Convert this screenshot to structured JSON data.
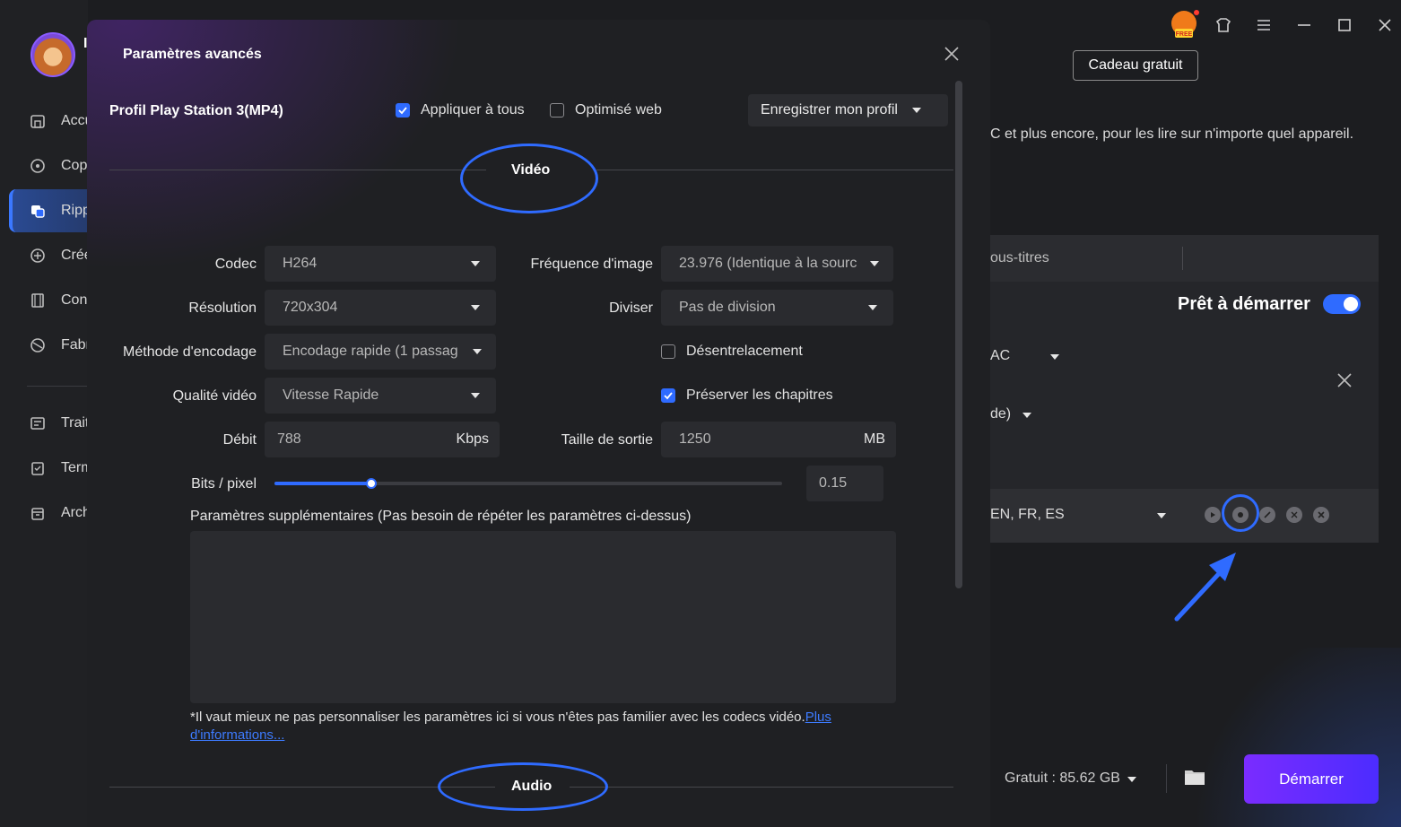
{
  "sidebar": {
    "logo_letter": "I",
    "items": [
      {
        "label": "Accueil",
        "icon": "home-icon"
      },
      {
        "label": "Copier",
        "icon": "copy-disc-icon"
      },
      {
        "label": "Ripper",
        "icon": "ripper-icon"
      },
      {
        "label": "Créer",
        "icon": "create-disc-icon"
      },
      {
        "label": "Convertir",
        "icon": "film-icon"
      },
      {
        "label": "Fabriquer",
        "icon": "fab-disc-icon"
      },
      {
        "label": "Traitement",
        "icon": "batch-icon"
      },
      {
        "label": "Terminé",
        "icon": "clipboard-icon"
      },
      {
        "label": "Archive",
        "icon": "archive-icon"
      }
    ],
    "active_index": 2
  },
  "window": {
    "gift_button": "Cadeau gratuit",
    "promo_badge": "FREE"
  },
  "background": {
    "description": "C et plus encore, pour les lire sur n'importe quel appareil.",
    "tab_subtitles": "ous-titres",
    "ready_label": "Prêt à démarrer",
    "audio_codec_partial": "AC",
    "mode_partial": "de)",
    "subtitle_langs": "EN, FR, ES",
    "free_space": "Gratuit : 85.62 GB",
    "start_button": "Démarrer"
  },
  "modal": {
    "title": "Paramètres avancés",
    "profile_name": "Profil Play Station 3(MP4)",
    "apply_all": {
      "label": "Appliquer à tous",
      "checked": true
    },
    "web_optimized": {
      "label": "Optimisé web",
      "checked": false
    },
    "save_profile": "Enregistrer mon profil",
    "video_section": "Vidéo",
    "audio_section": "Audio",
    "fields": {
      "codec": {
        "label": "Codec",
        "value": "H264"
      },
      "resolution": {
        "label": "Résolution",
        "value": "720x304"
      },
      "encoding_method": {
        "label": "Méthode d'encodage",
        "value": "Encodage rapide (1 passag"
      },
      "video_quality": {
        "label": "Qualité vidéo",
        "value": "Vitesse Rapide"
      },
      "bitrate": {
        "label": "Débit",
        "value": "788",
        "unit": "Kbps"
      },
      "frame_rate": {
        "label": "Fréquence d'image",
        "value": "23.976 (Identique à la sourc"
      },
      "split": {
        "label": "Diviser",
        "value": "Pas de division"
      },
      "deinterlace": {
        "label": "Désentrelacement",
        "checked": false
      },
      "keep_chapters": {
        "label": "Préserver les chapitres",
        "checked": true
      },
      "output_size": {
        "label": "Taille de sortie",
        "value": "1250",
        "unit": "MB"
      },
      "bits_per_pixel": {
        "label": "Bits / pixel",
        "value": "0.15",
        "slider_fraction": 0.19
      }
    },
    "extra_params_label": "Paramètres supplémentaires (Pas besoin de répéter les paramètres ci-dessus)",
    "extra_params_value": "",
    "note_text": "*Il vaut mieux ne pas personnaliser les paramètres ici si vous n'êtes pas familier avec les codecs vidéo.",
    "note_link_1": "Plus",
    "note_link_2": "d'informations..."
  },
  "colors": {
    "accent": "#2f6bff",
    "start_gradient_from": "#7a2cff",
    "start_gradient_to": "#4c2cff"
  }
}
